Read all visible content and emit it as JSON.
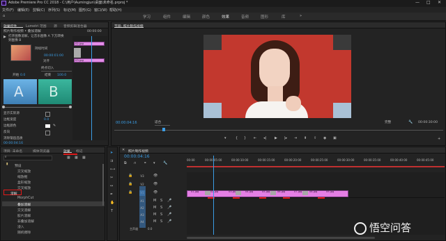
{
  "window": {
    "title": "Adobe Premiere Pro CC 2018 - C:\\用户\\Aumingjun\\桌面\\未命名.prproj *"
  },
  "menu": [
    "文件(F)",
    "编辑(E)",
    "剪辑(C)",
    "序列(S)",
    "标记(M)",
    "图形(G)",
    "窗口(W)",
    "帮助(H)"
  ],
  "workspaces": [
    "学习",
    "组件",
    "编辑",
    "颜色",
    "效果",
    "音频",
    "图形",
    "库"
  ],
  "effect_controls": {
    "tabs": [
      "效果控件",
      "Lumetri 范围",
      "源",
      "音频剪辑混合器"
    ],
    "clip_name": "照片制作视频 • 叠加溶解",
    "timecode_start": "00:00:00",
    "transition_desc": "打开图像溶解，让音乐图像 A 下方转换到图像 B",
    "duration_label": "持续时间",
    "duration_value": "00:00:01:00",
    "align_label": "对齐",
    "align_value": "终点切入",
    "start_label": "开始",
    "start_value": "0.0",
    "end_label": "结束",
    "end_value": "100.0",
    "a_letter": "A",
    "b_letter": "B",
    "show_actual_label": "显示实际源",
    "border_width_label": "边框宽度",
    "border_width_value": "0.0",
    "border_color_label": "边框颜色",
    "reverse_label": "反向",
    "antialias_label": "消除锯齿品质",
    "clip_a": "02.jpg",
    "clip_b": "03.jpg",
    "bottom_timecode": "00:00:04:16"
  },
  "program": {
    "title": "节目: 照片制作视频",
    "timecode": "00:00:04:16",
    "fit": "适合",
    "quality": "完整",
    "end_timecode": "00:00:30:00"
  },
  "project": {
    "tabs": [
      "项目: 未命名",
      "媒体浏览器",
      "效果",
      "标记"
    ],
    "items": [
      "预设",
      "交叉缩放",
      "缩放框",
      "盒形缩放",
      "交叉缩放",
      "缩放",
      "溶解",
      "MorphCut",
      "叠加溶解",
      "交叉溶解",
      "胶片溶解",
      "非叠加溶解",
      "浸入",
      "划出",
      "随机擦除"
    ]
  },
  "timeline": {
    "title": "照片制作视频",
    "timecode": "00:00:04:16",
    "ruler": [
      "00:00",
      "00:00:05:00",
      "00:00:10:00",
      "00:00:15:00",
      "00:00:20:00",
      "00:00:25:00",
      "00:00:30:00",
      "00:00:35:00",
      "00:00:40:00",
      "00:00:45:00"
    ],
    "video_tracks": [
      "V3",
      "V2",
      "V1"
    ],
    "audio_tracks": [
      "A1",
      "A2",
      "A3",
      "A4",
      "主声道"
    ],
    "clips": [
      "01.jpg",
      "02.jpg",
      "03.jpg",
      "04.jpg",
      "05.jpg",
      "06.jpg",
      "07.jpg",
      "08.jpg",
      "09.jpg"
    ],
    "master_value": "0.0"
  },
  "watermark": "悟空问答",
  "colors": {
    "accent": "#3b9de5",
    "clip": "#e48de8",
    "marker": "#e21a1a",
    "teal": "#2da18d",
    "sky": "#4f9bd2"
  }
}
